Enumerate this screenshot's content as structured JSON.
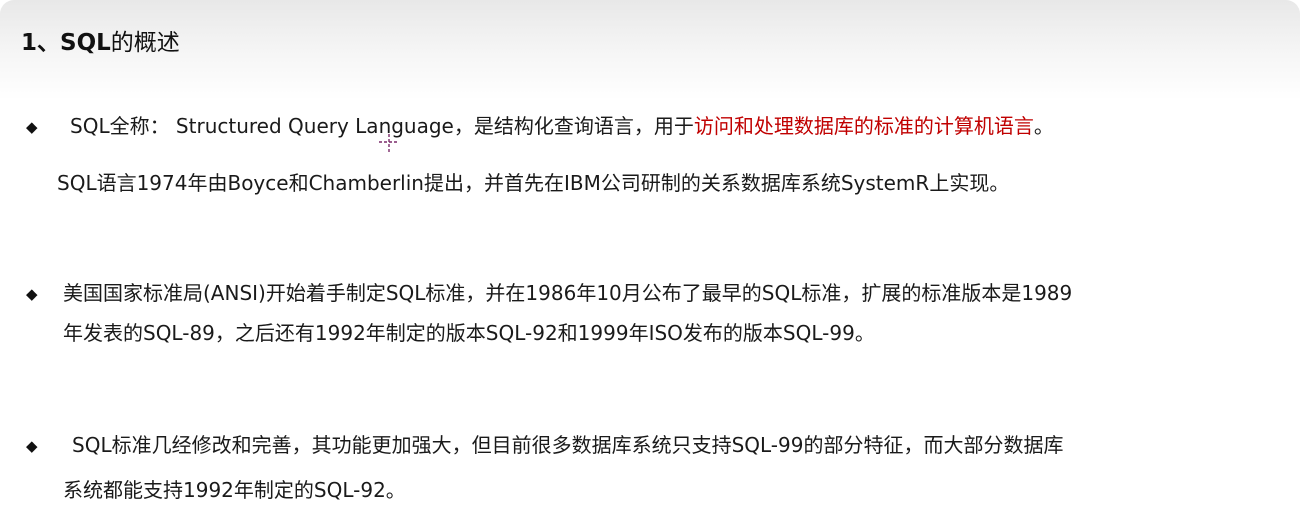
{
  "slide": {
    "title_num": "1、",
    "title_bold": "SQL",
    "title_rest": "的概述",
    "bullet_symbol": "◆",
    "p1": {
      "lead": "SQL全称： Structured Query Language，是结构化查询语言，用于",
      "highlight": "访问和处理数据库的标准的计算机语言",
      "tail": "。"
    },
    "p2": "SQL语言1974年由Boyce和Chamberlin提出，并首先在IBM公司研制的关系数据库系统SystemR上实现。",
    "p3_line1": "美国国家标准局(ANSI)开始着手制定SQL标准，并在1986年10月公布了最早的SQL标准，扩展的标准版本是1989",
    "p3_line2": "年发表的SQL-89，之后还有1992年制定的版本SQL-92和1999年ISO发布的版本SQL-99。",
    "p4_line1": "SQL标准几经修改和完善，其功能更加强大，但目前很多数据库系统只支持SQL-99的部分特征，而大部分数据库",
    "p4_line2": "系统都能支持1992年制定的SQL-92。",
    "highlight_color": "#c00000"
  }
}
